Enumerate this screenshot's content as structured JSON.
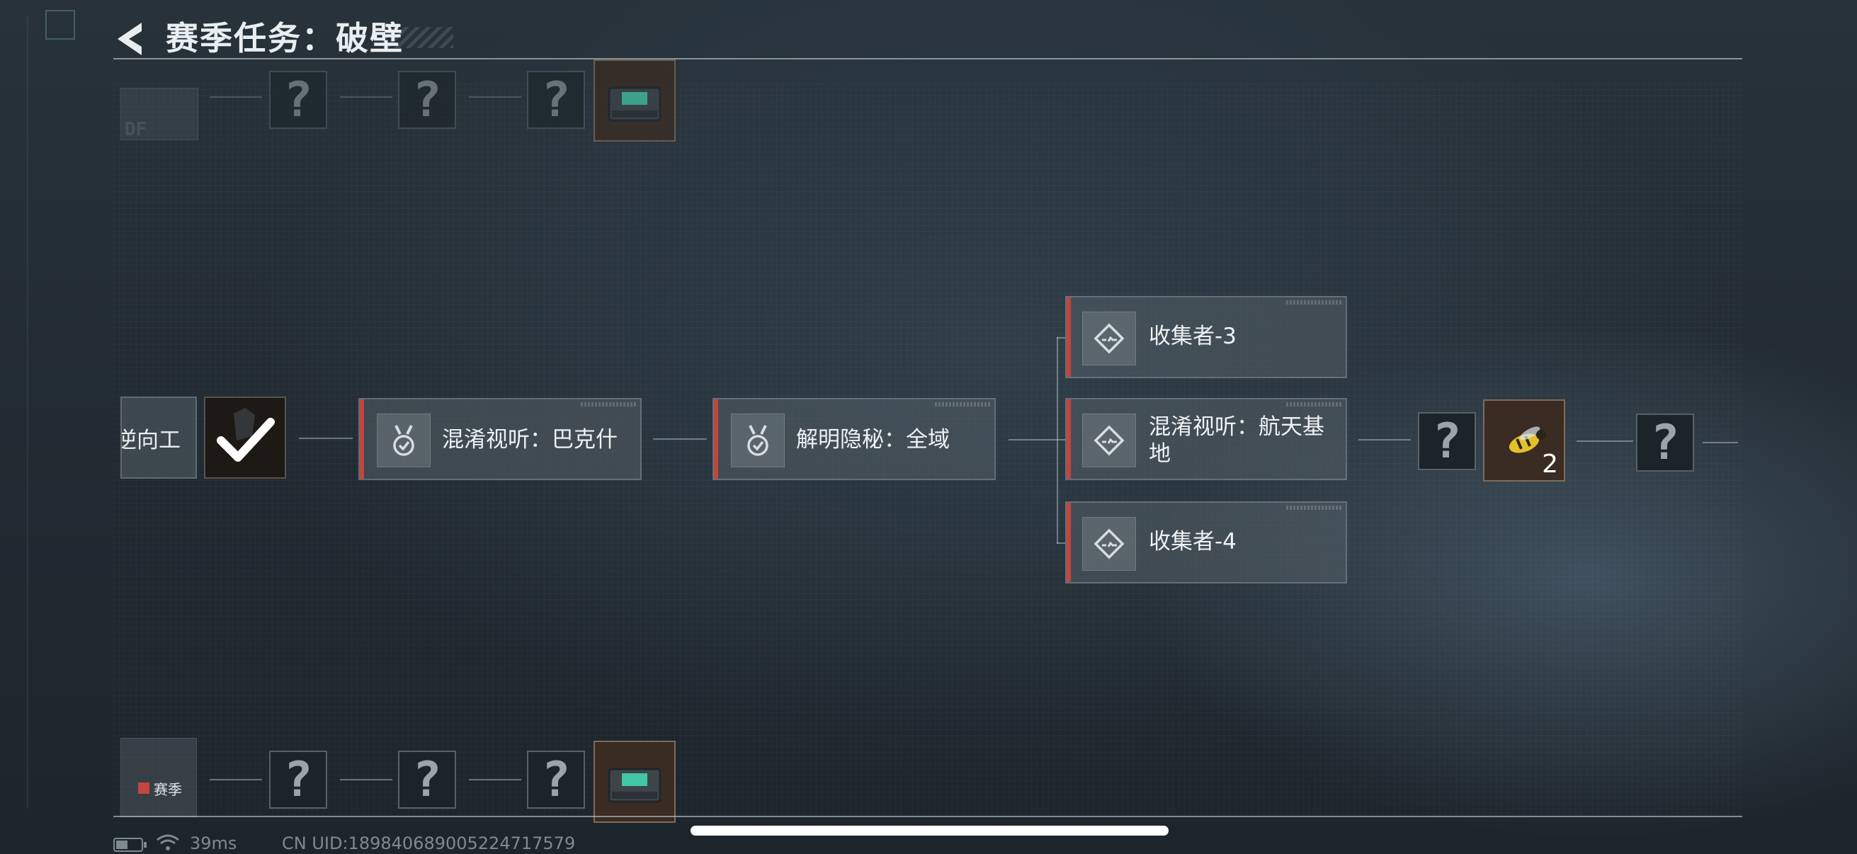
{
  "header": {
    "title": "赛季任务：破壁"
  },
  "left_card": {
    "label": "逆向工"
  },
  "tasks": [
    {
      "label": "混淆视听：巴克什"
    },
    {
      "label": "解明隐秘：全域"
    },
    {
      "label": "收集者-3"
    },
    {
      "label": "混淆视听：航天基地"
    },
    {
      "label": "收集者-4"
    }
  ],
  "mystery_symbol": "?",
  "reward_wasp": {
    "count": "2"
  },
  "season_legend": {
    "label": "赛季"
  },
  "top_left_code": "DF",
  "status_bar": {
    "ping": "39ms",
    "uid": "CN UID:1898406890052247175​79"
  },
  "colors": {
    "accent_red": "#c2463e",
    "background": "#222b33"
  },
  "icons": [
    "back-chevron-icon",
    "checkmark-icon",
    "medal-icon",
    "diamond-route-icon",
    "question-mark-icon",
    "crate-icon",
    "wasp-icon",
    "battery-icon",
    "wifi-icon"
  ]
}
